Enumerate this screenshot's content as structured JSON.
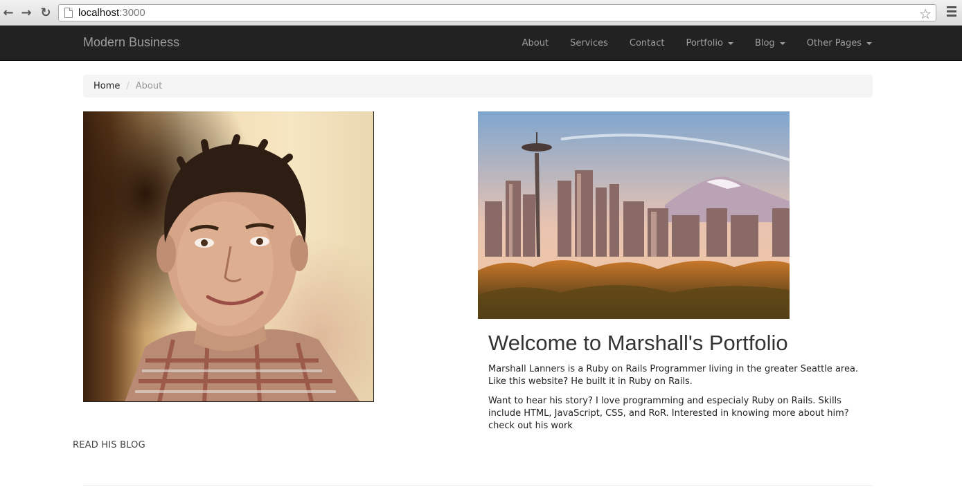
{
  "browser": {
    "url_host": "localhost",
    "url_port": ":3000"
  },
  "navbar": {
    "brand": "Modern Business",
    "links": [
      {
        "label": "About",
        "dropdown": false
      },
      {
        "label": "Services",
        "dropdown": false
      },
      {
        "label": "Contact",
        "dropdown": false
      },
      {
        "label": "Portfolio",
        "dropdown": true
      },
      {
        "label": "Blog",
        "dropdown": true
      },
      {
        "label": "Other Pages",
        "dropdown": true
      }
    ]
  },
  "breadcrumb": {
    "home": "Home",
    "separator": "/",
    "current": "About"
  },
  "main": {
    "heading": "Welcome to Marshall's Portfolio",
    "paragraph1": "Marshall Lanners is a Ruby on Rails Programmer living in the greater Seattle area. Like this website? He built it in Ruby on Rails.",
    "paragraph2": "Want to hear his story? I love programming and especialy Ruby on Rails. Skills include HTML, JavaScript, CSS, and RoR. Interested in knowing more about him? check out his work",
    "blog_link": "READ HIS BLOG"
  },
  "colors": {
    "navbar_bg": "#222222",
    "nav_text": "#9d9d9d",
    "breadcrumb_bg": "#f5f5f5"
  }
}
